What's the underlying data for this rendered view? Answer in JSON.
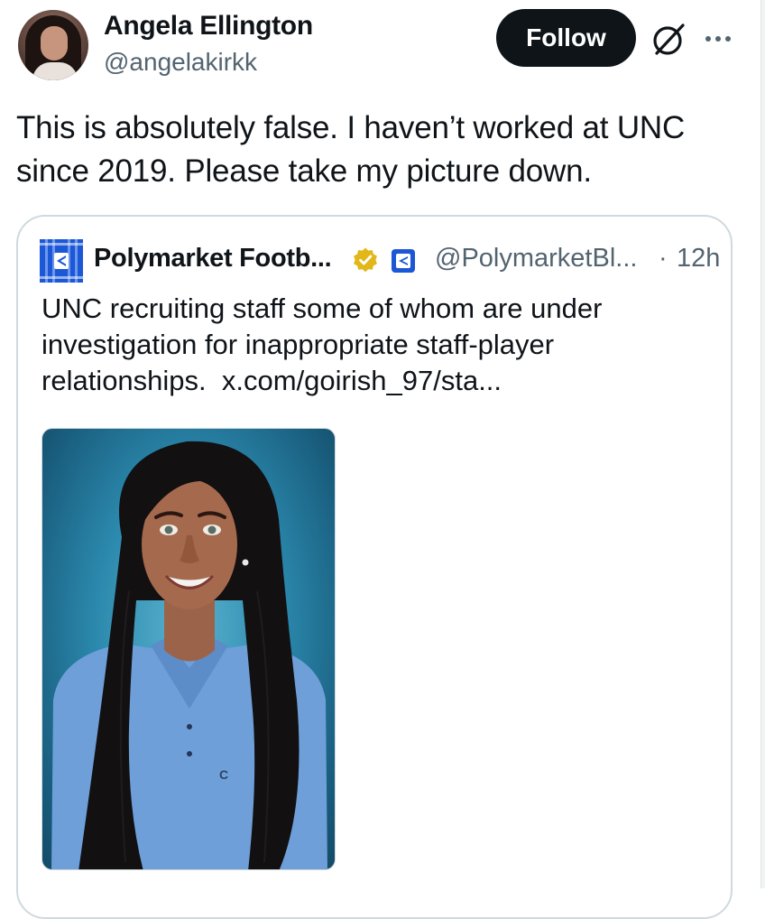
{
  "author": {
    "display_name": "Angela Ellington",
    "handle": "@angelakirkk"
  },
  "actions": {
    "follow_label": "Follow",
    "grok_icon": "grok-icon",
    "more_icon": "more-icon"
  },
  "tweet": {
    "text": "This is absolutely false. I haven’t worked at UNC since 2019. Please take my picture down."
  },
  "quote": {
    "display_name": "Polymarket Footb...",
    "handle": "@PolymarketBl...",
    "separator": "·",
    "time": "12h",
    "text": "UNC recruiting staff some of whom are under investigation for inappropriate staff-player relationships.",
    "link_text": "x.com/goirish_97/sta...",
    "verified_color": "#e2b719",
    "brand_color": "#1c57d6"
  },
  "colors": {
    "text_primary": "#0f1419",
    "text_secondary": "#536471",
    "border": "#cfd9de"
  }
}
